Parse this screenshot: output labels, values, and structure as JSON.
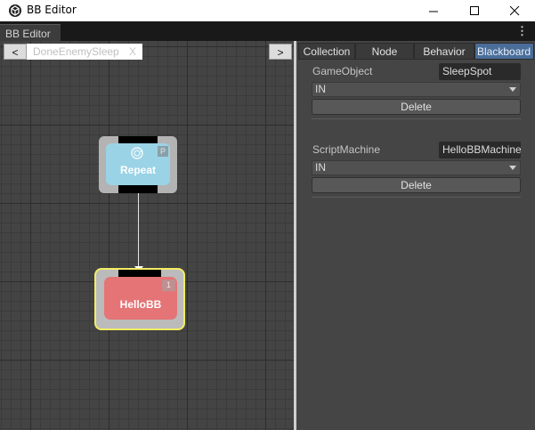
{
  "window": {
    "title": "BB Editor",
    "controls": {
      "minimize": "—",
      "maximize": "☐",
      "close": "✕"
    }
  },
  "tab": {
    "label": "BB Editor",
    "menu": "⋮"
  },
  "graph": {
    "prev_label": "<",
    "next_label": ">",
    "tree_name": "DoneEnemySleep",
    "tree_close": "X",
    "nodes": {
      "repeat": {
        "label": "Repeat",
        "badge": "P",
        "color": "#9bd3e6",
        "icon": "refresh-icon"
      },
      "hello": {
        "label": "HelloBB",
        "badge": "1",
        "color": "#e47476",
        "selected_outline": "#f3ec65"
      }
    }
  },
  "panel": {
    "tabs": {
      "collection": "Collection",
      "node": "Node",
      "behavior": "Behavior",
      "blackboard": "Blackboard"
    },
    "active_tab_color": "#4a6d99",
    "entries": [
      {
        "type": "GameObject",
        "value": "SleepSpot",
        "direction": "IN",
        "delete": "Delete"
      },
      {
        "type": "ScriptMachine",
        "value": "HelloBBMachine",
        "direction": "IN",
        "delete": "Delete"
      }
    ]
  }
}
